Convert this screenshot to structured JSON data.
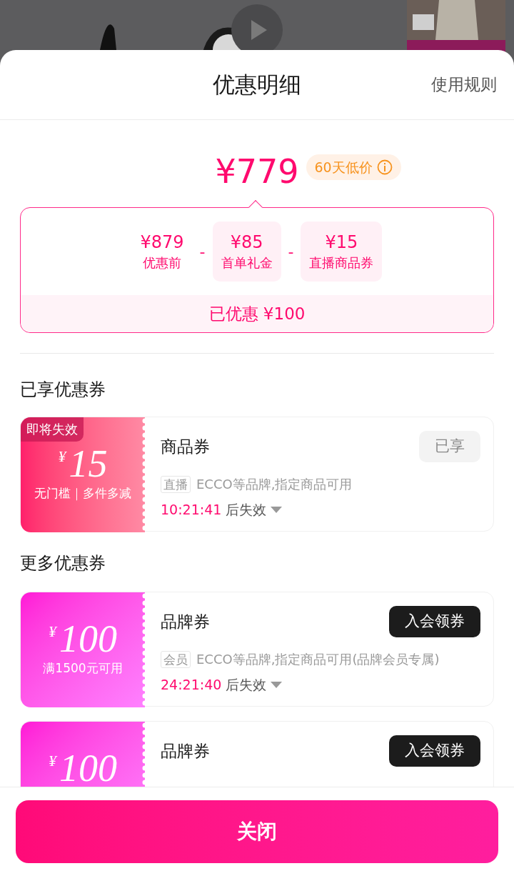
{
  "header": {
    "title": "优惠明细",
    "rules_link": "使用规则"
  },
  "price": {
    "amount": "¥779",
    "badge": "60天低价"
  },
  "breakdown": {
    "items": [
      {
        "amount": "¥879",
        "label": "优惠前",
        "highlighted": false
      },
      {
        "operator": "-",
        "amount": "¥85",
        "label": "首单礼金",
        "highlighted": true
      },
      {
        "operator": "-",
        "amount": "¥15",
        "label": "直播商品券",
        "highlighted": true
      }
    ],
    "total": "已优惠 ¥100"
  },
  "sections": [
    {
      "title": "已享优惠券",
      "coupons": [
        {
          "kind": "product",
          "badge": "即将失效",
          "currency": "¥",
          "amount": "15",
          "condition": "无门槛｜多件多减",
          "name": "商品券",
          "button": {
            "label": "已享",
            "disabled": true
          },
          "tag": "直播",
          "description": "ECCO等品牌,指定商品可用",
          "countdown": "10:21:41",
          "countdown_suffix": "后失效"
        }
      ]
    },
    {
      "title": "更多优惠券",
      "coupons": [
        {
          "kind": "brand",
          "currency": "¥",
          "amount": "100",
          "condition": "满1500元可用",
          "name": "品牌券",
          "button": {
            "label": "入会领券",
            "disabled": false
          },
          "tag": "会员",
          "description": "ECCO等品牌,指定商品可用(品牌会员专属)",
          "countdown": "24:21:40",
          "countdown_suffix": "后失效"
        },
        {
          "kind": "brand",
          "currency": "¥",
          "amount": "100",
          "name": "品牌券",
          "button": {
            "label": "入会领券",
            "disabled": false
          }
        }
      ]
    }
  ],
  "footer": {
    "close_button": "关闭"
  }
}
